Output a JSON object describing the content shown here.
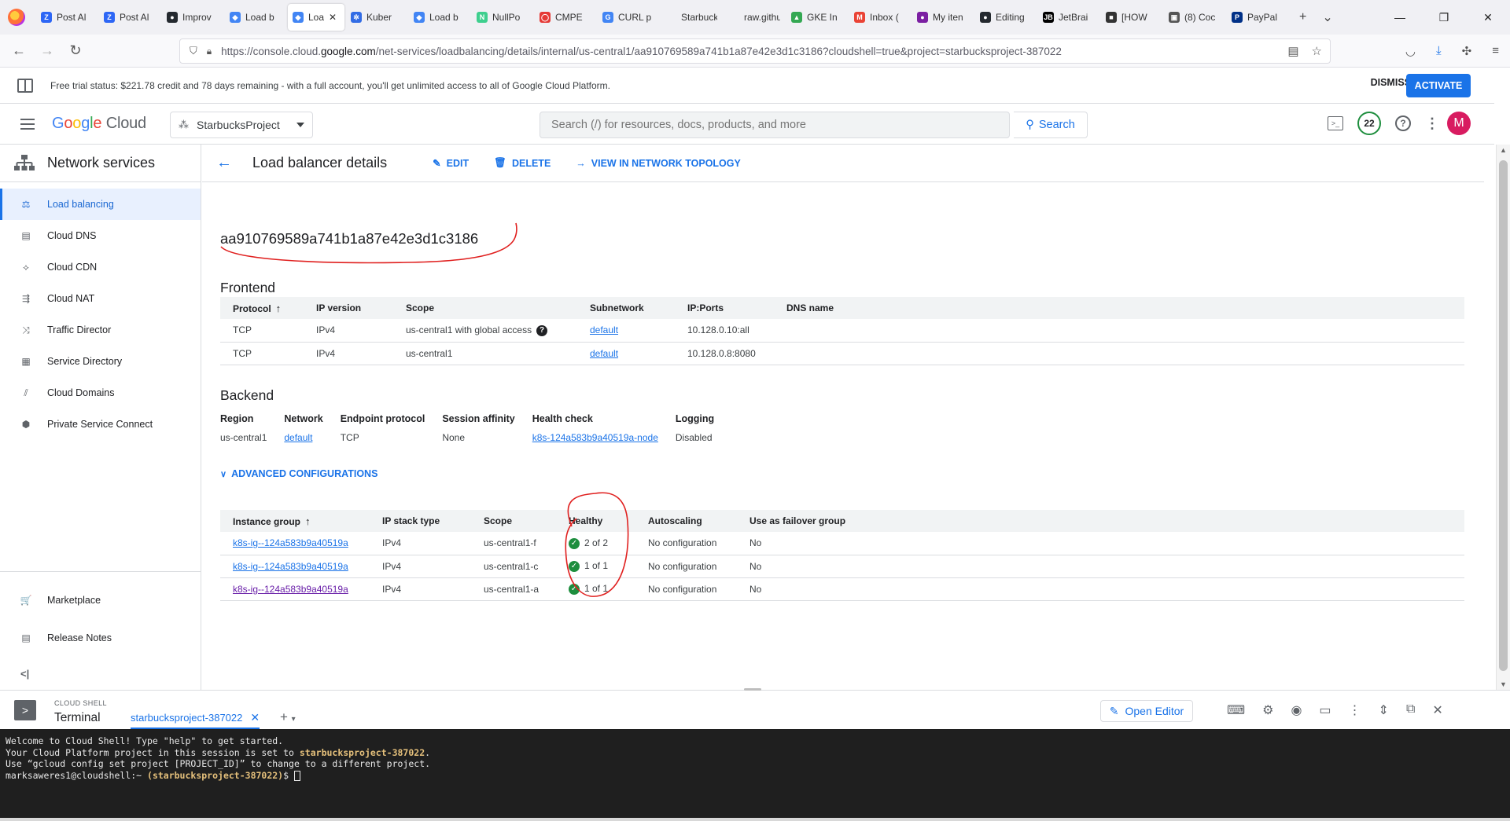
{
  "browser": {
    "tabs": [
      {
        "label": "Post Al",
        "fav": "Z",
        "color": "#2d66f5"
      },
      {
        "label": "Post Al",
        "fav": "Z",
        "color": "#2d66f5"
      },
      {
        "label": "Improv",
        "fav": "●",
        "color": "#24292f"
      },
      {
        "label": "Load b",
        "fav": "◆",
        "color": "#4285f4"
      },
      {
        "label": "Loa",
        "fav": "◆",
        "color": "#4285f4",
        "active": true
      },
      {
        "label": "Kuber",
        "fav": "✲",
        "color": "#326ce5"
      },
      {
        "label": "Load b",
        "fav": "◆",
        "color": "#4285f4"
      },
      {
        "label": "NullPo",
        "fav": "N",
        "color": "#3ecf8e"
      },
      {
        "label": "CMPE",
        "fav": "◯",
        "color": "#e53935"
      },
      {
        "label": "CURL p",
        "fav": "G",
        "color": "#4285f4"
      },
      {
        "label": "Starbucks",
        "fav": "",
        "color": "#f0f0f4"
      },
      {
        "label": "raw.githu",
        "fav": "",
        "color": "#f0f0f4"
      },
      {
        "label": "GKE In",
        "fav": "▲",
        "color": "#34a853"
      },
      {
        "label": "Inbox (",
        "fav": "M",
        "color": "#ea4335"
      },
      {
        "label": "My iten",
        "fav": "●",
        "color": "#7b1fa2"
      },
      {
        "label": "Editing",
        "fav": "●",
        "color": "#24292f"
      },
      {
        "label": "JetBrai",
        "fav": "JB",
        "color": "#000000"
      },
      {
        "label": "[HOW",
        "fav": "■",
        "color": "#333333"
      },
      {
        "label": "(8) Coc",
        "fav": "▣",
        "color": "#555555"
      },
      {
        "label": "PayPal",
        "fav": "P",
        "color": "#003087"
      }
    ],
    "url_prefix": "https://console.cloud.",
    "url_domain": "google.com",
    "url_suffix": "/net-services/loadbalancing/details/internal/us-central1/aa910769589a741b1a87e42e3d1c3186?cloudshell=true&project=starbucksproject-387022"
  },
  "trial": {
    "message": "Free trial status: $221.78 credit and 78 days remaining - with a full account, you'll get unlimited access to all of Google Cloud Platform.",
    "dismiss": "DISMISS",
    "activate": "ACTIVATE"
  },
  "header": {
    "logo_google": [
      "G",
      "o",
      "o",
      "g",
      "l",
      "e"
    ],
    "logo_cloud": "Cloud",
    "project": "StarbucksProject",
    "search_placeholder": "Search (/) for resources, docs, products, and more",
    "search_button": "Search",
    "notifications": "22",
    "avatar_letter": "M"
  },
  "sidebar": {
    "title": "Network services",
    "items": [
      {
        "label": "Load balancing",
        "icon": "load-balancing-icon",
        "glyph": "⚖"
      },
      {
        "label": "Cloud DNS",
        "icon": "dns-icon",
        "glyph": "▤"
      },
      {
        "label": "Cloud CDN",
        "icon": "cdn-icon",
        "glyph": "⟡"
      },
      {
        "label": "Cloud NAT",
        "icon": "nat-icon",
        "glyph": "⇶"
      },
      {
        "label": "Traffic Director",
        "icon": "traffic-director-icon",
        "glyph": "⤨"
      },
      {
        "label": "Service Directory",
        "icon": "service-directory-icon",
        "glyph": "▦"
      },
      {
        "label": "Cloud Domains",
        "icon": "domains-icon",
        "glyph": "⫽"
      },
      {
        "label": "Private Service Connect",
        "icon": "private-connect-icon",
        "glyph": "⬢"
      }
    ],
    "bottom": [
      {
        "label": "Marketplace",
        "icon": "marketplace-icon",
        "glyph": "🛒"
      },
      {
        "label": "Release Notes",
        "icon": "release-notes-icon",
        "glyph": "▤"
      }
    ],
    "collapse": "<|"
  },
  "page": {
    "title": "Load balancer details",
    "edit": "EDIT",
    "delete": "DELETE",
    "topology": "VIEW IN NETWORK TOPOLOGY",
    "lb_name": "aa910769589a741b1a87e42e3d1c3186",
    "frontend_title": "Frontend",
    "frontend": {
      "columns": [
        "Protocol",
        "IP version",
        "Scope",
        "Subnetwork",
        "IP:Ports",
        "DNS name"
      ],
      "rows": [
        {
          "protocol": "TCP",
          "ip_version": "IPv4",
          "scope": "us-central1 with global access",
          "subnetwork": "default",
          "ip_ports": "10.128.0.10:all",
          "dns": ""
        },
        {
          "protocol": "TCP",
          "ip_version": "IPv4",
          "scope": "us-central1",
          "subnetwork": "default",
          "ip_ports": "10.128.0.8:8080",
          "dns": ""
        }
      ]
    },
    "backend_title": "Backend",
    "backend": {
      "region_label": "Region",
      "region": "us-central1",
      "network_label": "Network",
      "network": "default",
      "endpoint_label": "Endpoint protocol",
      "endpoint": "TCP",
      "affinity_label": "Session affinity",
      "affinity": "None",
      "health_label": "Health check",
      "health": "k8s-124a583b9a40519a-node",
      "logging_label": "Logging",
      "logging": "Disabled"
    },
    "advanced": "ADVANCED CONFIGURATIONS",
    "instances": {
      "columns": [
        "Instance group",
        "IP stack type",
        "Scope",
        "Healthy",
        "Autoscaling",
        "Use as failover group"
      ],
      "rows": [
        {
          "group": "k8s-ig--124a583b9a40519a",
          "stack": "IPv4",
          "scope": "us-central1-f",
          "healthy": "2 of 2",
          "autoscaling": "No configuration",
          "failover": "No"
        },
        {
          "group": "k8s-ig--124a583b9a40519a",
          "stack": "IPv4",
          "scope": "us-central1-c",
          "healthy": "1 of 1",
          "autoscaling": "No configuration",
          "failover": "No"
        },
        {
          "group": "k8s-ig--124a583b9a40519a",
          "stack": "IPv4",
          "scope": "us-central1-a",
          "healthy": "1 of 1",
          "autoscaling": "No configuration",
          "failover": "No"
        }
      ]
    }
  },
  "shell": {
    "label": "CLOUD SHELL",
    "terminal": "Terminal",
    "tab": "starbucksproject-387022",
    "open_editor": "Open Editor",
    "lines": {
      "l1": "Welcome to Cloud Shell! Type \"help\" to get started.",
      "l2_a": "Your Cloud Platform project in this session is set to ",
      "l2_b": "starbucksproject-387022",
      "l2_c": ".",
      "l3": "Use “gcloud config set project [PROJECT_ID]” to change to a different project.",
      "l4_a": "marksaweres1@cloudshell:~ ",
      "l4_b": "(starbucksproject-387022)",
      "l4_c": "$ "
    }
  },
  "annotation_color": "#e0201f"
}
